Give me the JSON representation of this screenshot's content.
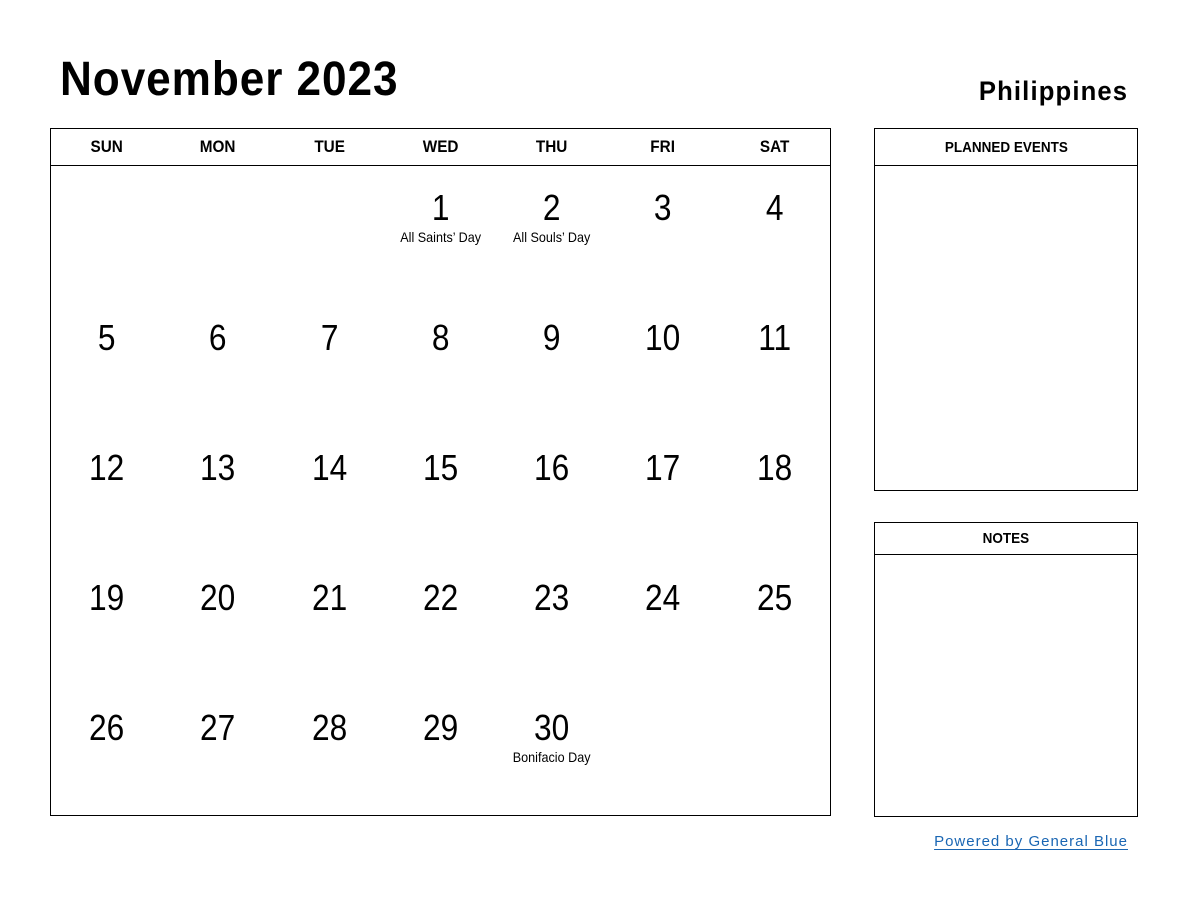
{
  "header": {
    "title": "November 2023",
    "country": "Philippines"
  },
  "calendar": {
    "weekdays": [
      "SUN",
      "MON",
      "TUE",
      "WED",
      "THU",
      "FRI",
      "SAT"
    ],
    "weeks": [
      [
        {
          "day": ""
        },
        {
          "day": ""
        },
        {
          "day": ""
        },
        {
          "day": "1",
          "holiday": "All Saints’ Day"
        },
        {
          "day": "2",
          "holiday": "All Souls’ Day"
        },
        {
          "day": "3"
        },
        {
          "day": "4"
        }
      ],
      [
        {
          "day": "5"
        },
        {
          "day": "6"
        },
        {
          "day": "7"
        },
        {
          "day": "8"
        },
        {
          "day": "9"
        },
        {
          "day": "10"
        },
        {
          "day": "11"
        }
      ],
      [
        {
          "day": "12"
        },
        {
          "day": "13"
        },
        {
          "day": "14"
        },
        {
          "day": "15"
        },
        {
          "day": "16"
        },
        {
          "day": "17"
        },
        {
          "day": "18"
        }
      ],
      [
        {
          "day": "19"
        },
        {
          "day": "20"
        },
        {
          "day": "21"
        },
        {
          "day": "22"
        },
        {
          "day": "23"
        },
        {
          "day": "24"
        },
        {
          "day": "25"
        }
      ],
      [
        {
          "day": "26"
        },
        {
          "day": "27"
        },
        {
          "day": "28"
        },
        {
          "day": "29"
        },
        {
          "day": "30",
          "holiday": "Bonifacio Day"
        },
        {
          "day": ""
        },
        {
          "day": ""
        }
      ]
    ]
  },
  "sidebar": {
    "planned_events_label": "PLANNED EVENTS",
    "notes_label": "NOTES"
  },
  "footer": {
    "powered_by": "Powered by General Blue",
    "link_color": "#1a66b3"
  }
}
